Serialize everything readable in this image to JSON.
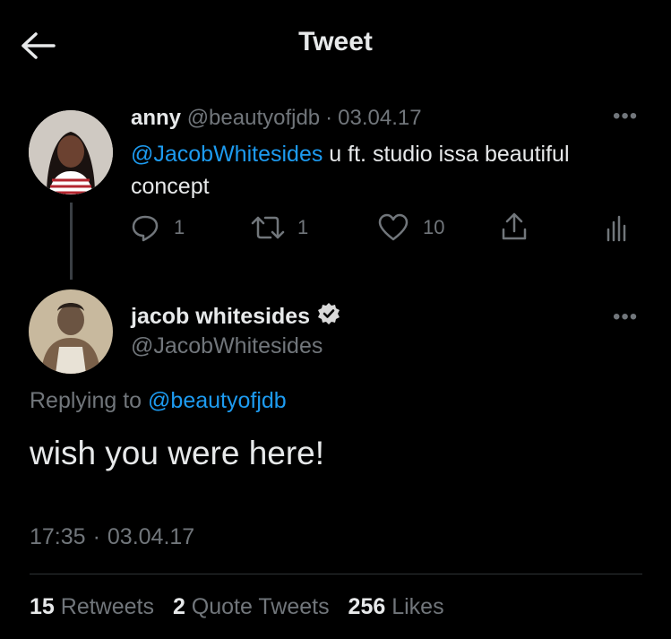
{
  "header": {
    "title": "Tweet"
  },
  "parent_tweet": {
    "name": "anny",
    "handle": "@beautyofjdb",
    "separator": "·",
    "date": "03.04.17",
    "mention": "@JacobWhitesides",
    "text_line1": " u ft. studio issa beautiful",
    "text_line2": "concept",
    "replies": "1",
    "retweets": "1",
    "likes": "10"
  },
  "main_tweet": {
    "name": "jacob whitesides",
    "handle": "@JacobWhitesides",
    "replying_prefix": "Replying to ",
    "replying_to": "@beautyofjdb",
    "text": "wish you were here!",
    "time": "17:35",
    "separator": "·",
    "date": "03.04.17"
  },
  "stats": {
    "retweets_count": "15",
    "retweets_label": "Retweets",
    "quotes_count": "2",
    "quotes_label": "Quote Tweets",
    "likes_count": "256",
    "likes_label": "Likes"
  },
  "colors": {
    "background": "#000000",
    "link": "#1d9bf0",
    "muted": "#71767b",
    "verified": "#d9d9d9"
  }
}
